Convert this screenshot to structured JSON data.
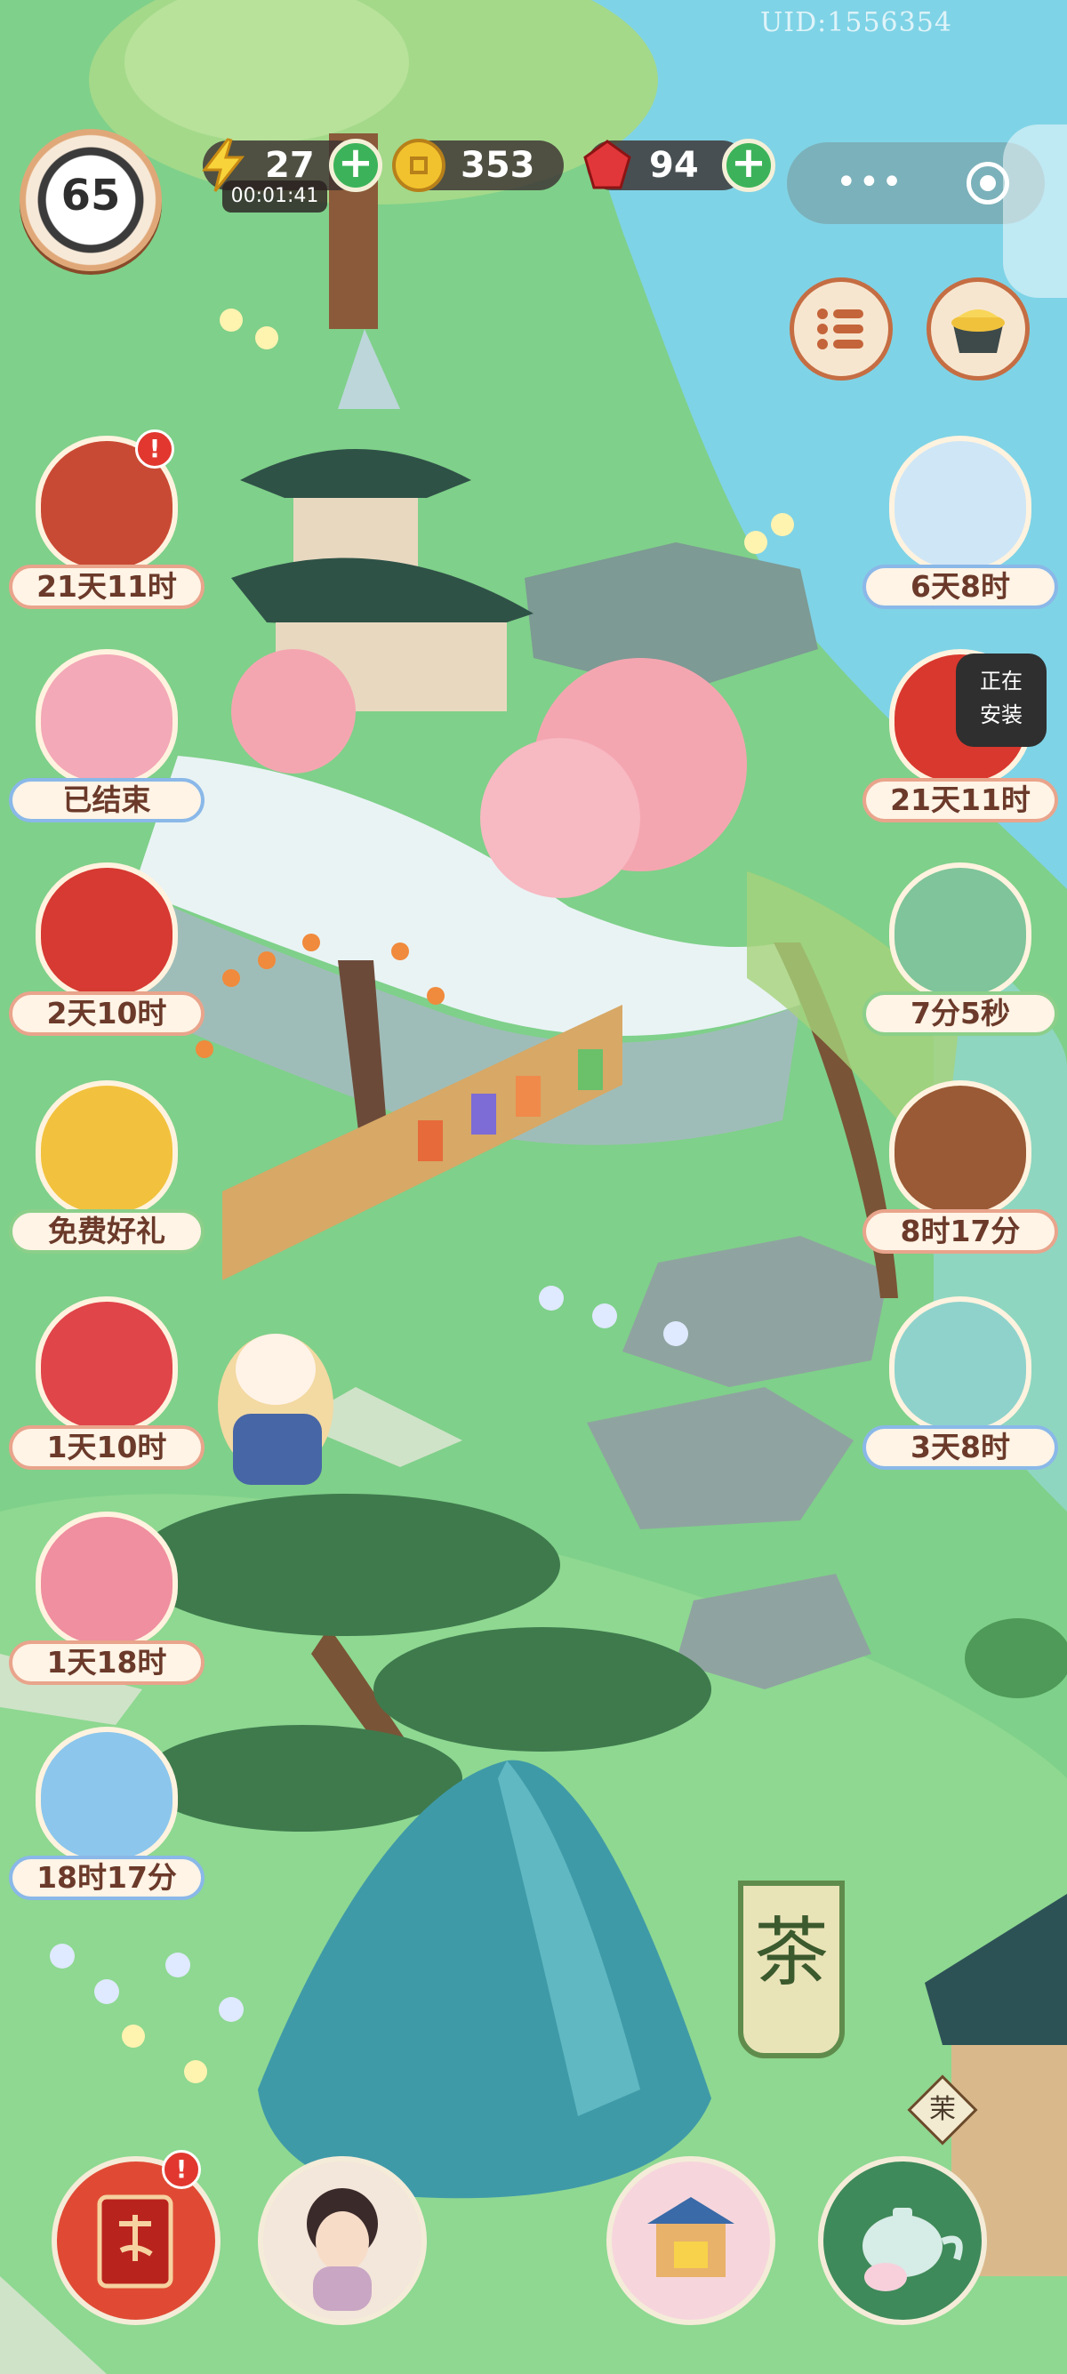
{
  "uid": "UID:1556354",
  "player": {
    "level": "65"
  },
  "resources": {
    "energy": {
      "value": "27",
      "timer": "00:01:41",
      "icon": "lightning-icon"
    },
    "coins": {
      "value": "353",
      "icon": "coin-icon"
    },
    "gems": {
      "value": "94",
      "icon": "gem-icon"
    }
  },
  "left_events": [
    {
      "timer": "21天11时",
      "alert": "!",
      "icon": "letter-scroll-icon"
    },
    {
      "timer": "已结束",
      "icon": "pink-fan-icon"
    },
    {
      "timer": "2天10时",
      "icon": "gong-icon"
    },
    {
      "timer": "免费好礼",
      "icon": "free-gift-knot-icon"
    },
    {
      "timer": "1天10时",
      "icon": "cat-drum-icon"
    },
    {
      "timer": "1天18时",
      "icon": "mouse-flowers-icon"
    },
    {
      "timer": "18时17分",
      "icon": "koi-fish-icon"
    }
  ],
  "right_events": [
    {
      "timer": "6天8时",
      "icon": "cat-hammer-icon"
    },
    {
      "timer": "21天11时",
      "icon": "gold-treasure-icon"
    },
    {
      "timer": "7分5秒",
      "icon": "cat-cart-icon"
    },
    {
      "timer": "8时17分",
      "icon": "door-crest-icon"
    },
    {
      "timer": "3天8时",
      "icon": "cat-giftbox-icon"
    }
  ],
  "install_notice": {
    "line1": "正在",
    "line2": "安装"
  },
  "shop": {
    "banner": "茶",
    "sign": "茉"
  },
  "bottom_bar": [
    {
      "icon": "red-book-icon",
      "alert": "!"
    },
    {
      "icon": "lady-portrait-icon"
    },
    {
      "icon": "shop-stall-icon"
    },
    {
      "icon": "teapot-icon"
    }
  ],
  "colors": {
    "grass": "#7fd08a",
    "water": "#7fd3e6",
    "label_border": "#e9a48c",
    "alert": "#e2372f",
    "plus": "#3cb35a"
  }
}
